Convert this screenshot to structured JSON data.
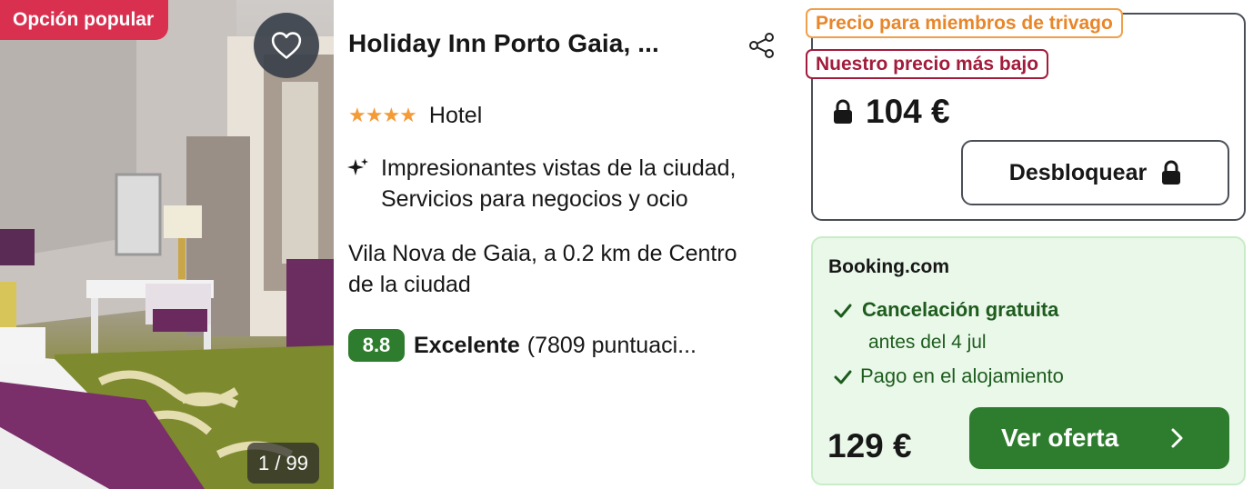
{
  "photo": {
    "badge": "Opción popular",
    "counter": "1 / 99",
    "favorite_icon": "heart-outline-icon"
  },
  "hotel": {
    "name": "Holiday Inn Porto Gaia, ...",
    "stars": "★★★★",
    "star_count": 4,
    "type": "Hotel",
    "amenities_line1": "Impresionantes vistas de la ciudad,",
    "amenities_line2": "Servicios para negocios y ocio",
    "location_line1": "Vila Nova de Gaia, a 0.2 km de Centro",
    "location_line2": "de la ciudad",
    "score": "8.8",
    "rating_label": "Excelente",
    "rating_count": "(7809 puntuaci..."
  },
  "member_offer": {
    "tag_member": "Precio para miembros de trivago",
    "tag_lowest": "Nuestro precio más bajo",
    "price": "104 €",
    "unlock_label": "Desbloquear"
  },
  "deal": {
    "provider": "Booking.com",
    "cancel_title": "Cancelación gratuita",
    "cancel_until": "antes del 4 jul",
    "payment": "Pago en el alojamiento",
    "price": "129 €",
    "cta_label": "Ver oferta"
  },
  "colors": {
    "popular_badge": "#d9304f",
    "member_tag": "#e8862a",
    "lowest_tag": "#a21c3c",
    "score_bg": "#2e7d2e",
    "deal_bg": "#eaf8ea",
    "cta_bg": "#2e7d2e",
    "star": "#f49b37"
  }
}
